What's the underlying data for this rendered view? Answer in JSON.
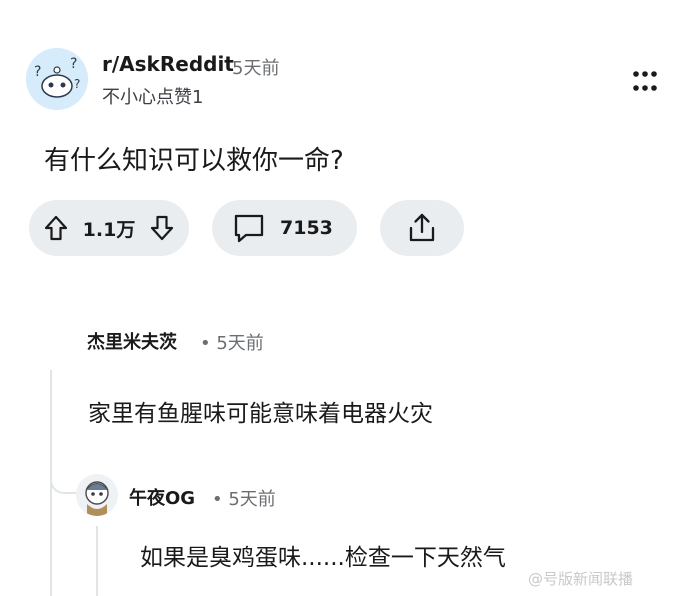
{
  "post": {
    "subreddit": "r/AskReddit",
    "time": "5天前",
    "author": "不小心点赞1",
    "title": "有什么知识可以救你一命?",
    "votes": "1.1万",
    "comments": "7153",
    "more_icon": "more-vertical-icon",
    "upvote_icon": "arrow-up-icon",
    "downvote_icon": "arrow-down-icon",
    "comment_icon": "comment-bubble-icon",
    "share_icon": "share-icon"
  },
  "comments": [
    {
      "author": "杰里米夫茨",
      "meta": "• 5天前",
      "body": "家里有鱼腥味可能意味着电器火灾"
    },
    {
      "author": "午夜OG",
      "meta": "• 5天前",
      "body": "如果是臭鸡蛋味......检查一下天然气"
    }
  ],
  "watermark": "@号版新闻联播"
}
